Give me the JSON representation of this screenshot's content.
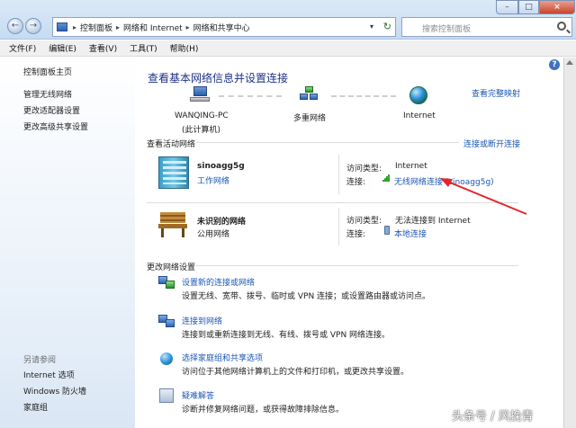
{
  "address_bar": {
    "crumbs": [
      "控制面板",
      "网络和 Internet",
      "网络和共享中心"
    ],
    "search_placeholder": "搜索控制面板"
  },
  "menu": [
    "文件(F)",
    "编辑(E)",
    "查看(V)",
    "工具(T)",
    "帮助(H)"
  ],
  "left_pane": {
    "home": "控制面板主页",
    "links": [
      "管理无线网络",
      "更改适配器设置",
      "更改高级共享设置"
    ],
    "see_also_label": "另请参阅",
    "see_also": [
      "Internet 选项",
      "Windows 防火墙",
      "家庭组"
    ]
  },
  "main": {
    "title": "查看基本网络信息并设置连接",
    "full_map": "查看完整映射",
    "map": {
      "pc_name": "WANQING-PC",
      "pc_sub": "(此计算机)",
      "middle": "多重网络",
      "right": "Internet"
    },
    "active_label": "查看活动网络",
    "connect_link": "连接或断开连接",
    "networks": [
      {
        "name": "sinoagg5g",
        "type": "工作网络",
        "access_label": "访问类型:",
        "access_value": "Internet",
        "conn_label": "连接:",
        "conn_value": "无线网络连接 (sinoagg5g)"
      },
      {
        "name": "未识别的网络",
        "type": "公用网络",
        "access_label": "访问类型:",
        "access_value": "无法连接到 Internet",
        "conn_label": "连接:",
        "conn_value": "本地连接"
      }
    ],
    "change_label": "更改网络设置",
    "tasks": [
      {
        "title": "设置新的连接或网络",
        "desc": "设置无线、宽带、拨号、临时或 VPN 连接；或设置路由器或访问点。"
      },
      {
        "title": "连接到网络",
        "desc": "连接到或重新连接到无线、有线、拨号或 VPN 网络连接。"
      },
      {
        "title": "选择家庭组和共享选项",
        "desc": "访问位于其他网络计算机上的文件和打印机，或更改共享设置。"
      },
      {
        "title": "疑难解答",
        "desc": "诊断并修复网络问题，或获得故障排除信息。"
      }
    ]
  },
  "watermark": "头条号 / 风挽青",
  "colors": {
    "link": "#1c58b5",
    "title": "#1e3287",
    "arrow": "#e3262b"
  }
}
